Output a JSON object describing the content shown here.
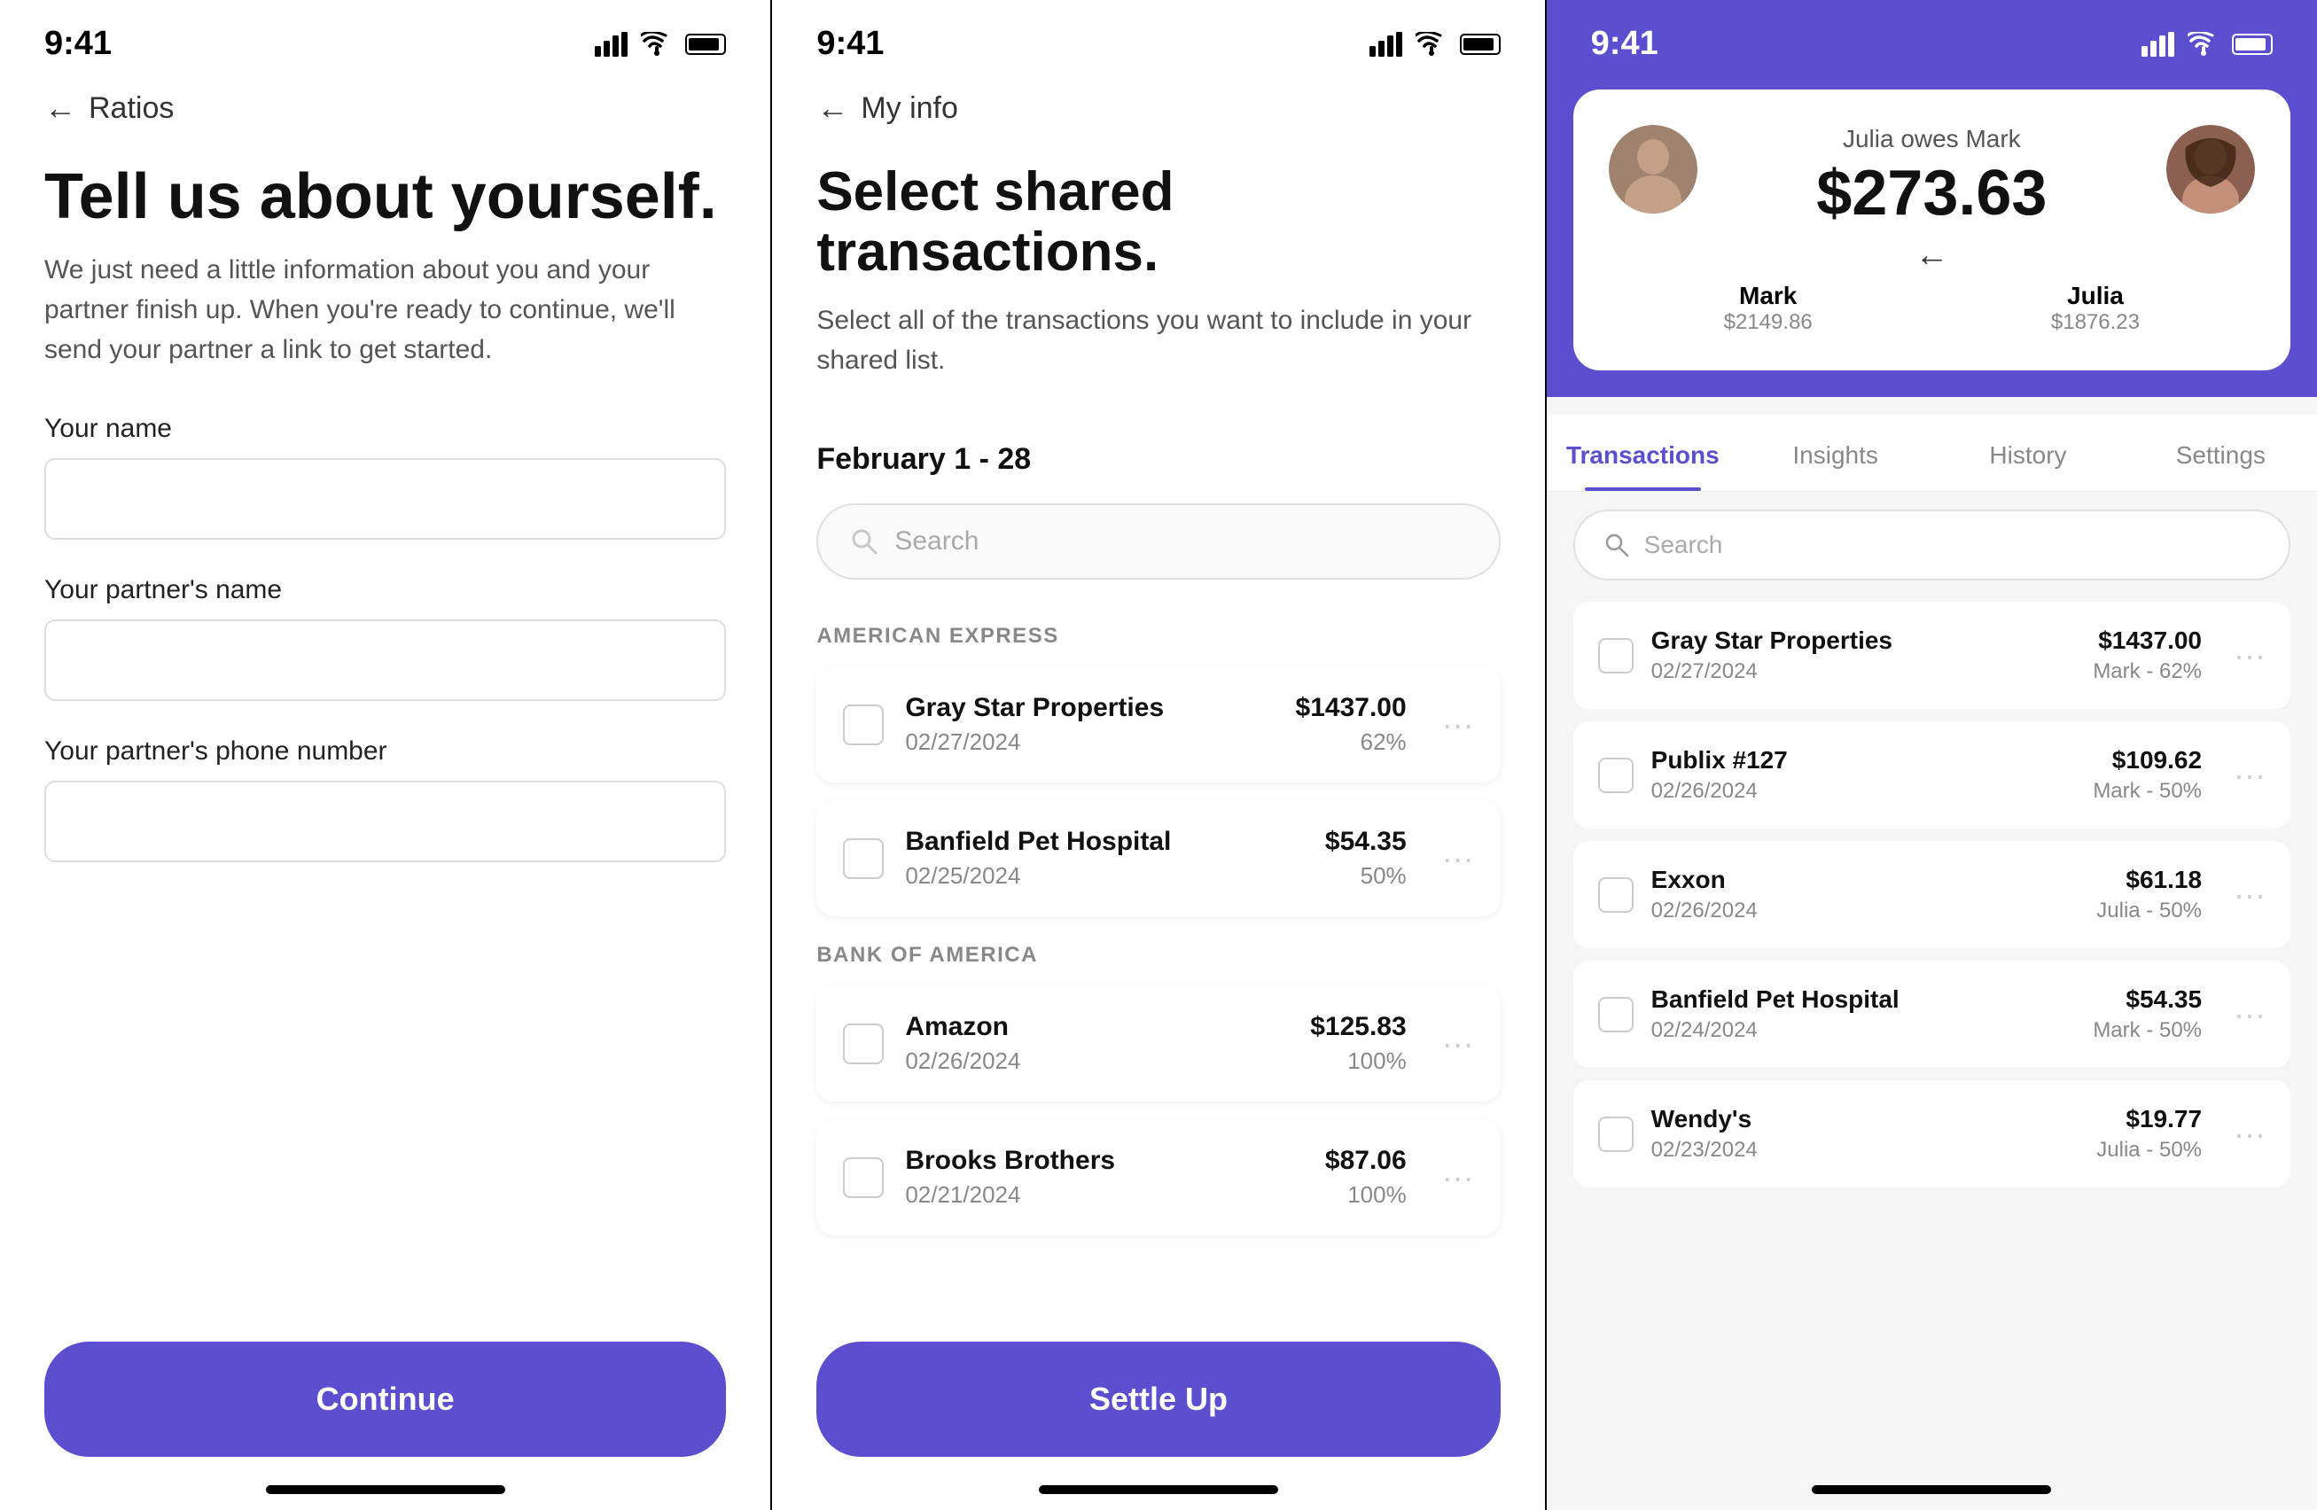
{
  "phone1": {
    "statusTime": "9:41",
    "backLabel": "Ratios",
    "title": "Tell us about yourself.",
    "subtitle": "We just need a little information about you and your partner finish up. When you're ready to continue, we'll send your partner a link to get started.",
    "yourNameLabel": "Your name",
    "yourNamePlaceholder": "",
    "partnerNameLabel": "Your partner's name",
    "partnerNamePlaceholder": "",
    "partnerPhoneLabel": "Your partner's phone number",
    "partnerPhonePlaceholder": "",
    "continueBtn": "Continue"
  },
  "phone2": {
    "statusTime": "9:41",
    "backLabel": "My info",
    "title": "Select shared transactions.",
    "subtitle": "Select all of the transactions you want to include in your shared list.",
    "dateRange": "February 1 - 28",
    "searchPlaceholder": "Search",
    "sections": [
      {
        "bank": "AMERICAN EXPRESS",
        "transactions": [
          {
            "name": "Gray Star Properties",
            "date": "02/27/2024",
            "amount": "$1437.00",
            "pct": "62%"
          },
          {
            "name": "Banfield Pet Hospital",
            "date": "02/25/2024",
            "amount": "$54.35",
            "pct": "50%"
          }
        ]
      },
      {
        "bank": "BANK OF AMERICA",
        "transactions": [
          {
            "name": "Amazon",
            "date": "02/26/2024",
            "amount": "$125.83",
            "pct": "100%"
          },
          {
            "name": "Brooks Brothers",
            "date": "02/21/2024",
            "amount": "$87.06",
            "pct": "100%"
          }
        ]
      }
    ],
    "settleBtn": "Settle Up"
  },
  "phone3": {
    "statusTime": "9:41",
    "balanceLabel": "Julia owes Mark",
    "balanceAmount": "$273.63",
    "markName": "Mark",
    "markAmount": "$2149.86",
    "juliaName": "Julia",
    "juliaAmount": "$1876.23",
    "tabs": [
      "Transactions",
      "Insights",
      "History",
      "Settings"
    ],
    "activeTab": "Transactions",
    "searchPlaceholder": "Search",
    "transactions": [
      {
        "name": "Gray Star Properties",
        "date": "02/27/2024",
        "amount": "$1437.00",
        "sub": "Mark - 62%"
      },
      {
        "name": "Publix #127",
        "date": "02/26/2024",
        "amount": "$109.62",
        "sub": "Mark - 50%"
      },
      {
        "name": "Exxon",
        "date": "02/26/2024",
        "amount": "$61.18",
        "sub": "Julia - 50%"
      },
      {
        "name": "Banfield Pet Hospital",
        "date": "02/24/2024",
        "amount": "$54.35",
        "sub": "Mark - 50%"
      },
      {
        "name": "Wendy's",
        "date": "02/23/2024",
        "amount": "$19.77",
        "sub": "Julia - 50%"
      }
    ]
  }
}
